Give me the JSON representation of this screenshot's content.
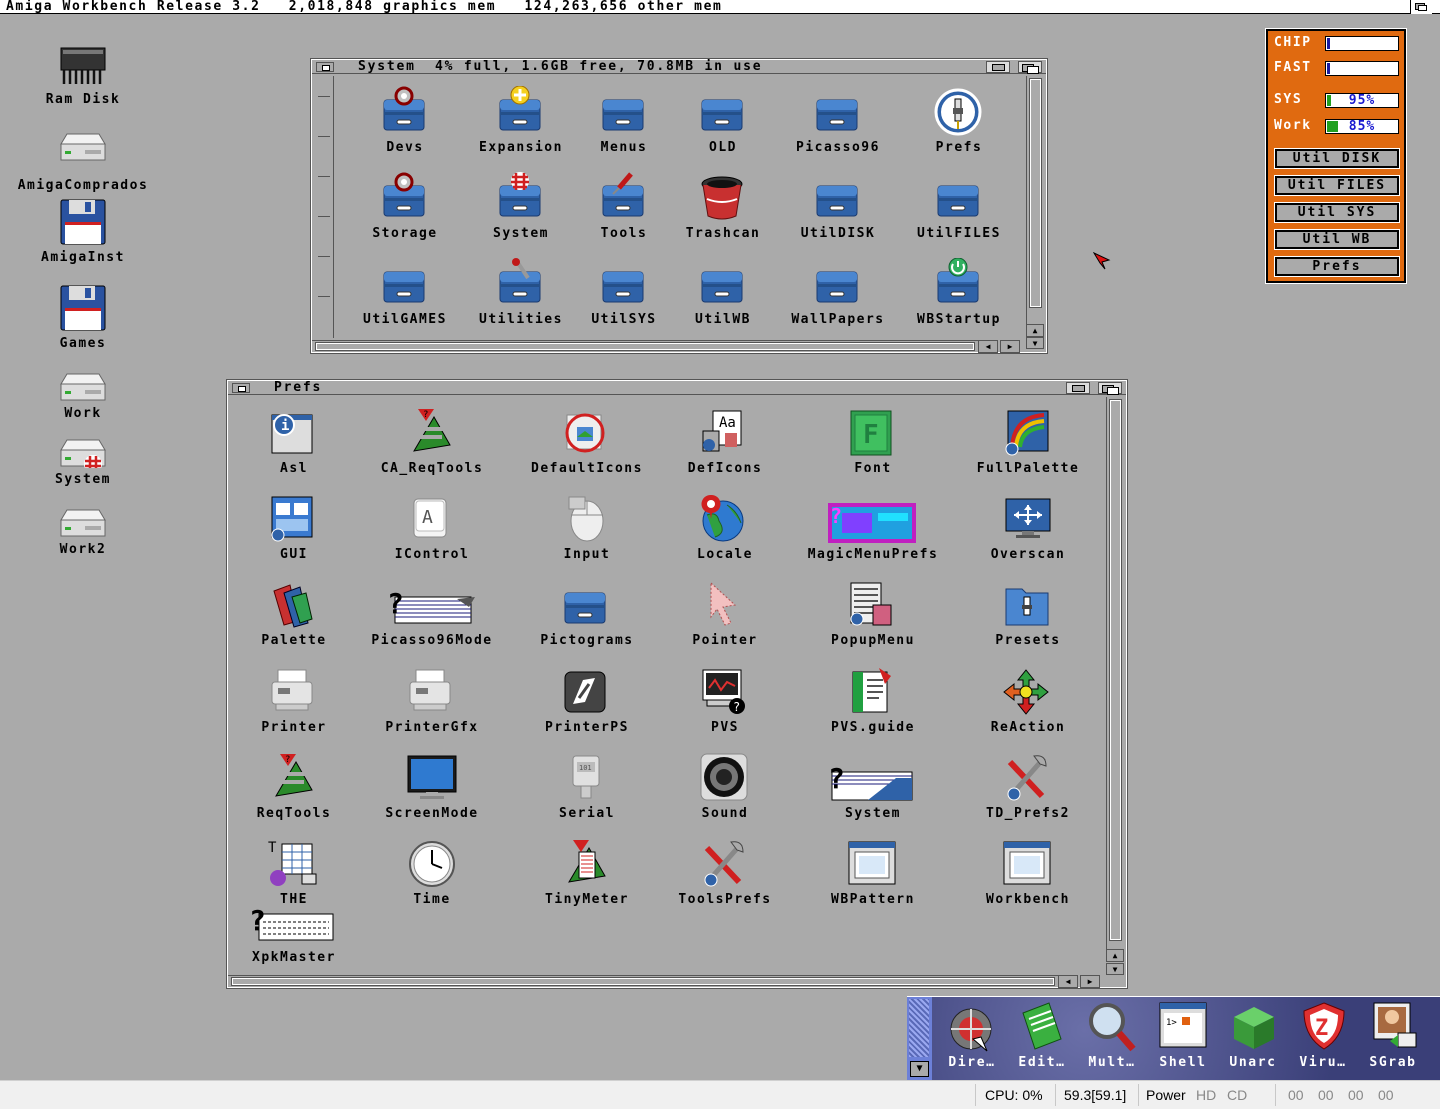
{
  "screen": {
    "title": "Amiga Workbench Release 3.2   2,018,848 graphics mem   124,263,656 other mem"
  },
  "desktop_icons": [
    {
      "label": "Ram Disk",
      "icon": "ram-disk-icon"
    },
    {
      "label": "AmigaComprados",
      "icon": "harddisk-icon"
    },
    {
      "label": "AmigaInst",
      "icon": "floppy-icon"
    },
    {
      "label": "Games",
      "icon": "floppy-icon"
    },
    {
      "label": "Work",
      "icon": "harddisk-icon"
    },
    {
      "label": "System",
      "icon": "harddisk-boing-icon"
    },
    {
      "label": "Work2",
      "icon": "harddisk-icon"
    }
  ],
  "system_window": {
    "title": "System  4% full, 1.6GB free, 70.8MB in use",
    "icons": [
      {
        "label": "Devs",
        "icon": "drawer-gears-icon"
      },
      {
        "label": "Expansion",
        "icon": "drawer-plus-icon"
      },
      {
        "label": "Menus",
        "icon": "drawer-icon"
      },
      {
        "label": "OLD",
        "icon": "drawer-icon"
      },
      {
        "label": "Picasso96",
        "icon": "drawer-icon"
      },
      {
        "label": "Prefs",
        "icon": "prefs-round-icon"
      },
      {
        "label": "Storage",
        "icon": "drawer-gears-icon"
      },
      {
        "label": "System",
        "icon": "drawer-boing-icon"
      },
      {
        "label": "Tools",
        "icon": "drawer-screwdriver-icon"
      },
      {
        "label": "Trashcan",
        "icon": "trashcan-icon"
      },
      {
        "label": "UtilDISK",
        "icon": "drawer-icon"
      },
      {
        "label": "UtilFILES",
        "icon": "drawer-icon"
      },
      {
        "label": "UtilGAMES",
        "icon": "drawer-icon"
      },
      {
        "label": "Utilities",
        "icon": "drawer-wrench-icon"
      },
      {
        "label": "UtilSYS",
        "icon": "drawer-icon"
      },
      {
        "label": "UtilWB",
        "icon": "drawer-icon"
      },
      {
        "label": "WallPapers",
        "icon": "drawer-icon"
      },
      {
        "label": "WBStartup",
        "icon": "drawer-power-icon"
      }
    ]
  },
  "prefs_window": {
    "title": "Prefs",
    "icons": [
      {
        "label": "Asl",
        "icon": "asl-icon"
      },
      {
        "label": "CA_ReqTools",
        "icon": "reqtools-icon"
      },
      {
        "label": "DefaultIcons",
        "icon": "defaulticons-icon"
      },
      {
        "label": "DefIcons",
        "icon": "deficons-icon"
      },
      {
        "label": "Font",
        "icon": "font-icon"
      },
      {
        "label": "FullPalette",
        "icon": "fullpalette-icon"
      },
      {
        "label": "GUI",
        "icon": "gui-icon"
      },
      {
        "label": "IControl",
        "icon": "icontrol-icon"
      },
      {
        "label": "Input",
        "icon": "mouse-icon"
      },
      {
        "label": "Locale",
        "icon": "globe-icon"
      },
      {
        "label": "MagicMenuPrefs",
        "icon": "magicmenu-icon"
      },
      {
        "label": "Overscan",
        "icon": "monitor-arrows-icon"
      },
      {
        "label": "Palette",
        "icon": "palette-icon"
      },
      {
        "label": "Picasso96Mode",
        "icon": "picasso-icon"
      },
      {
        "label": "Pictograms",
        "icon": "drawer-icon"
      },
      {
        "label": "Pointer",
        "icon": "pointer-icon"
      },
      {
        "label": "PopupMenu",
        "icon": "popupmenu-icon"
      },
      {
        "label": "Presets",
        "icon": "presets-folder-icon"
      },
      {
        "label": "Printer",
        "icon": "printer-icon"
      },
      {
        "label": "PrinterGfx",
        "icon": "printer-icon"
      },
      {
        "label": "PrinterPS",
        "icon": "printerps-icon"
      },
      {
        "label": "PVS",
        "icon": "pvs-icon"
      },
      {
        "label": "PVS.guide",
        "icon": "guide-icon"
      },
      {
        "label": "ReAction",
        "icon": "reaction-icon"
      },
      {
        "label": "ReqTools",
        "icon": "reqtools-icon"
      },
      {
        "label": "ScreenMode",
        "icon": "monitor-icon"
      },
      {
        "label": "Serial",
        "icon": "serial-icon"
      },
      {
        "label": "Sound",
        "icon": "speaker-icon"
      },
      {
        "label": "System",
        "icon": "system-icon"
      },
      {
        "label": "TD_Prefs2",
        "icon": "tools-icon"
      },
      {
        "label": "THE",
        "icon": "the-icon"
      },
      {
        "label": "Time",
        "icon": "clock-icon"
      },
      {
        "label": "TinyMeter",
        "icon": "tinymeter-icon"
      },
      {
        "label": "ToolsPrefs",
        "icon": "tools-icon"
      },
      {
        "label": "WBPattern",
        "icon": "window-icon"
      },
      {
        "label": "Workbench",
        "icon": "window-icon"
      },
      {
        "label": "XpkMaster",
        "icon": "xpk-icon"
      }
    ]
  },
  "meter": {
    "chip_label": "CHIP",
    "fast_label": "FAST",
    "sys_label": "SYS",
    "sys_pct": "95%",
    "sys_fill": 0.05,
    "work_label": "Work",
    "work_pct": "85%",
    "work_fill": 0.15,
    "chip_fill": 0.04,
    "fast_fill": 0.04,
    "buttons": [
      "Util DISK",
      "Util FILES",
      "Util SYS",
      "Util WB",
      "Prefs"
    ],
    "colors": {
      "panel": "#e06a10",
      "bar": "#1a1aa0",
      "work_bar": "#20a020"
    }
  },
  "dock": {
    "items": [
      {
        "label": "Dire…",
        "icon": "directory-opus-icon"
      },
      {
        "label": "Edit…",
        "icon": "edit-pad-icon"
      },
      {
        "label": "Mult…",
        "icon": "magnifier-icon"
      },
      {
        "label": "Shell",
        "icon": "shell-icon"
      },
      {
        "label": "Unarc",
        "icon": "unarc-cube-icon"
      },
      {
        "label": "Viru…",
        "icon": "virus-shield-icon"
      },
      {
        "label": "SGrab",
        "icon": "sgrab-icon"
      }
    ]
  },
  "statusbar": {
    "cpu": "CPU: 0%",
    "fps": "59.3[59.1]",
    "power": "Power",
    "hd": "HD",
    "cd": "CD",
    "drives": [
      "00",
      "00",
      "00",
      "00"
    ]
  }
}
